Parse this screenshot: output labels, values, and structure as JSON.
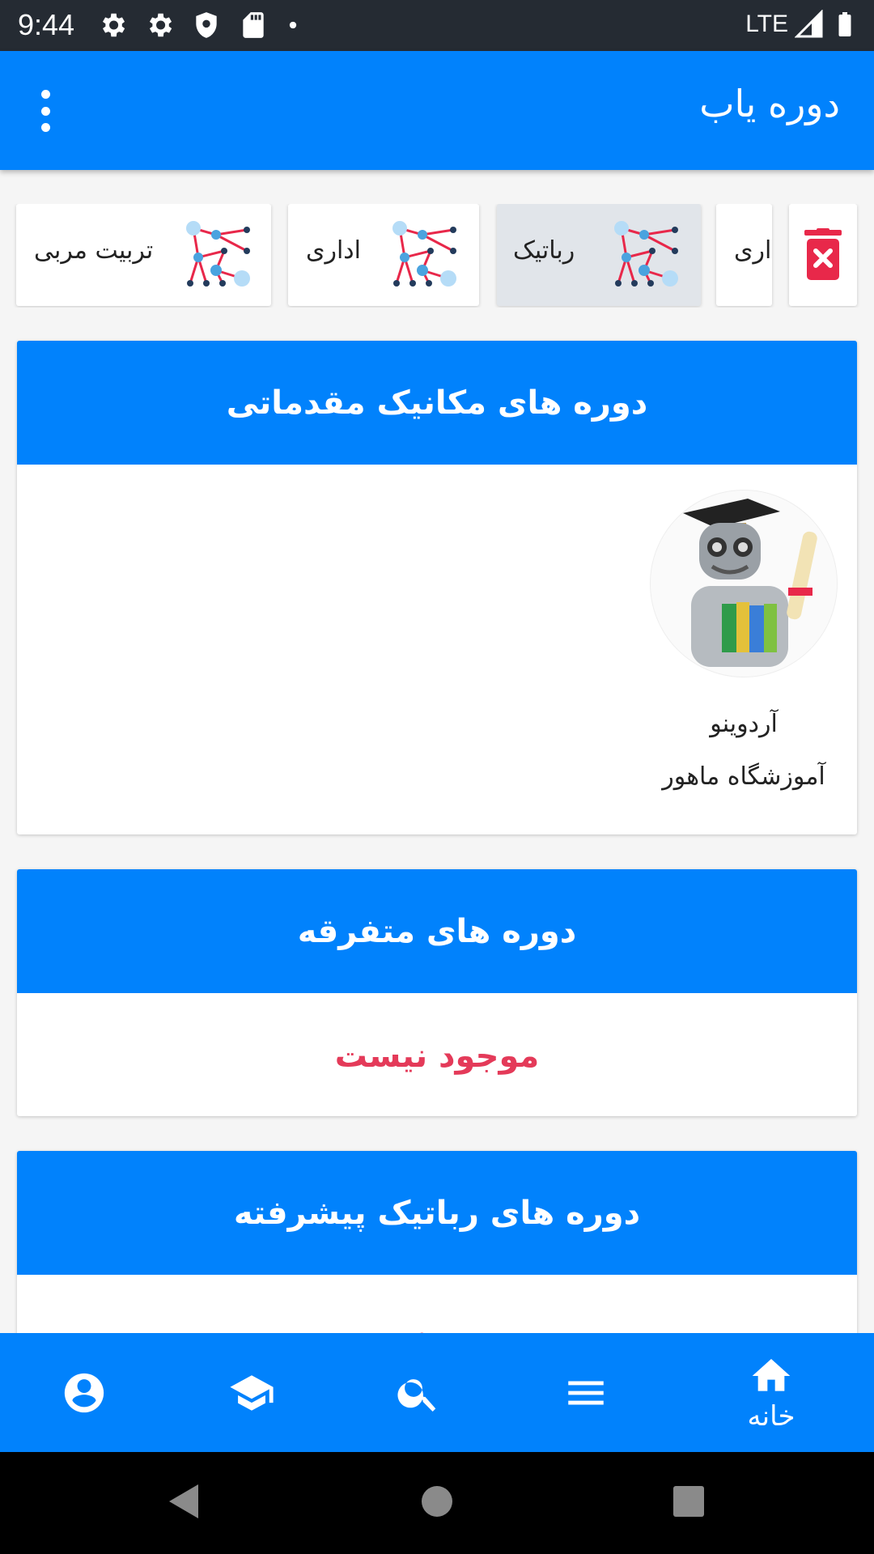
{
  "status_bar": {
    "time": "9:44",
    "network": "LTE"
  },
  "app_bar": {
    "title": "دوره یاب"
  },
  "categories": [
    {
      "label": "اداری"
    },
    {
      "label": "رباتیک"
    },
    {
      "label": "اداری"
    },
    {
      "label": "تربیت مربی"
    }
  ],
  "sections": [
    {
      "title": "دوره های مکانیک مقدماتی",
      "course": {
        "name": "آردوینو",
        "school": "آموزشگاه ماهور"
      }
    },
    {
      "title": "دوره های متفرقه",
      "empty": "موجود نیست"
    },
    {
      "title": "دوره های رباتیک پیشرفته",
      "empty": "موجود نیست"
    }
  ],
  "bottom_nav": {
    "home_label": "خانه"
  },
  "colors": {
    "primary": "#0182fc",
    "empty": "#e43a59",
    "delete": "#e8284a",
    "status_bar": "#252b33"
  }
}
